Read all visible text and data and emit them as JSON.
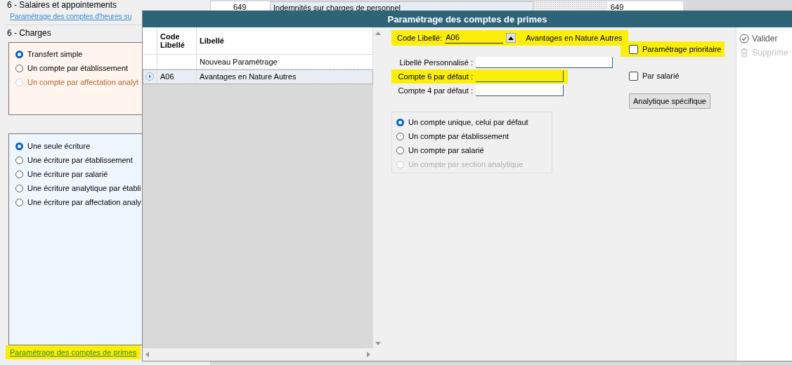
{
  "background": {
    "left_panel": {
      "heading": "6 - Salaires et appointements",
      "link": "Paramétrage des comptes d'heures su",
      "section": "6 - Charges",
      "charges_options": [
        {
          "label": "Transfert simple",
          "selected": true,
          "disabled": false
        },
        {
          "label": "Un compte par établissement",
          "selected": false,
          "disabled": false
        },
        {
          "label": "Un compte par affectation analyt",
          "selected": false,
          "disabled": true
        }
      ],
      "ecriture_options": [
        {
          "label": "Une seule écriture",
          "selected": true
        },
        {
          "label": "Une écriture par établissement",
          "selected": false
        },
        {
          "label": "Une écriture par salarié",
          "selected": false
        },
        {
          "label": "Une écriture analytique par établi",
          "selected": false
        },
        {
          "label": "Une écriture par affectation analy",
          "selected": false
        }
      ],
      "bottom_link": {
        "text": "Paramétrage des comptes de primes",
        "highlighted": true
      }
    },
    "table_row": {
      "cells": [
        "649",
        "Indemnités sur charges de personnel",
        "649"
      ]
    }
  },
  "dialog": {
    "title": "Paramétrage des comptes de primes",
    "grid": {
      "columns": [
        "Code Libellé",
        "Libellé"
      ],
      "rows": [
        {
          "label": "Nouveau Paramétrage",
          "selected": false
        },
        {
          "code": "A06",
          "label": "Avantages en Nature Autres",
          "selected": true
        }
      ]
    },
    "code_field": {
      "label": "Code Libellé:",
      "value": "A06",
      "description": "Avantages en Nature Autres",
      "highlighted": true
    },
    "fields": [
      {
        "label": "Libellé Personnalisé :",
        "highlighted": false
      },
      {
        "label": "Compte 6 par défaut :",
        "highlighted": true
      },
      {
        "label": "Compte 4 par défaut :",
        "highlighted": false
      }
    ],
    "account_options": [
      {
        "label": "Un compte unique, celui par défaut",
        "selected": true,
        "disabled": false
      },
      {
        "label": "Un compte par établissement",
        "selected": false,
        "disabled": false
      },
      {
        "label": "Un compte par salarié",
        "selected": false,
        "disabled": false
      },
      {
        "label": "Un compte par section analytique",
        "selected": false,
        "disabled": true
      }
    ],
    "checkboxes": [
      {
        "label": "Paramétrage prioritaire",
        "checked": false,
        "highlighted": true
      },
      {
        "label": "Par salarié",
        "checked": false,
        "highlighted": false
      }
    ],
    "specific_button": "Analytique spécifique",
    "actions": [
      {
        "label": "Valider",
        "kind": "validate",
        "disabled": false
      },
      {
        "label": "Supprime",
        "kind": "delete",
        "disabled": true
      }
    ]
  }
}
